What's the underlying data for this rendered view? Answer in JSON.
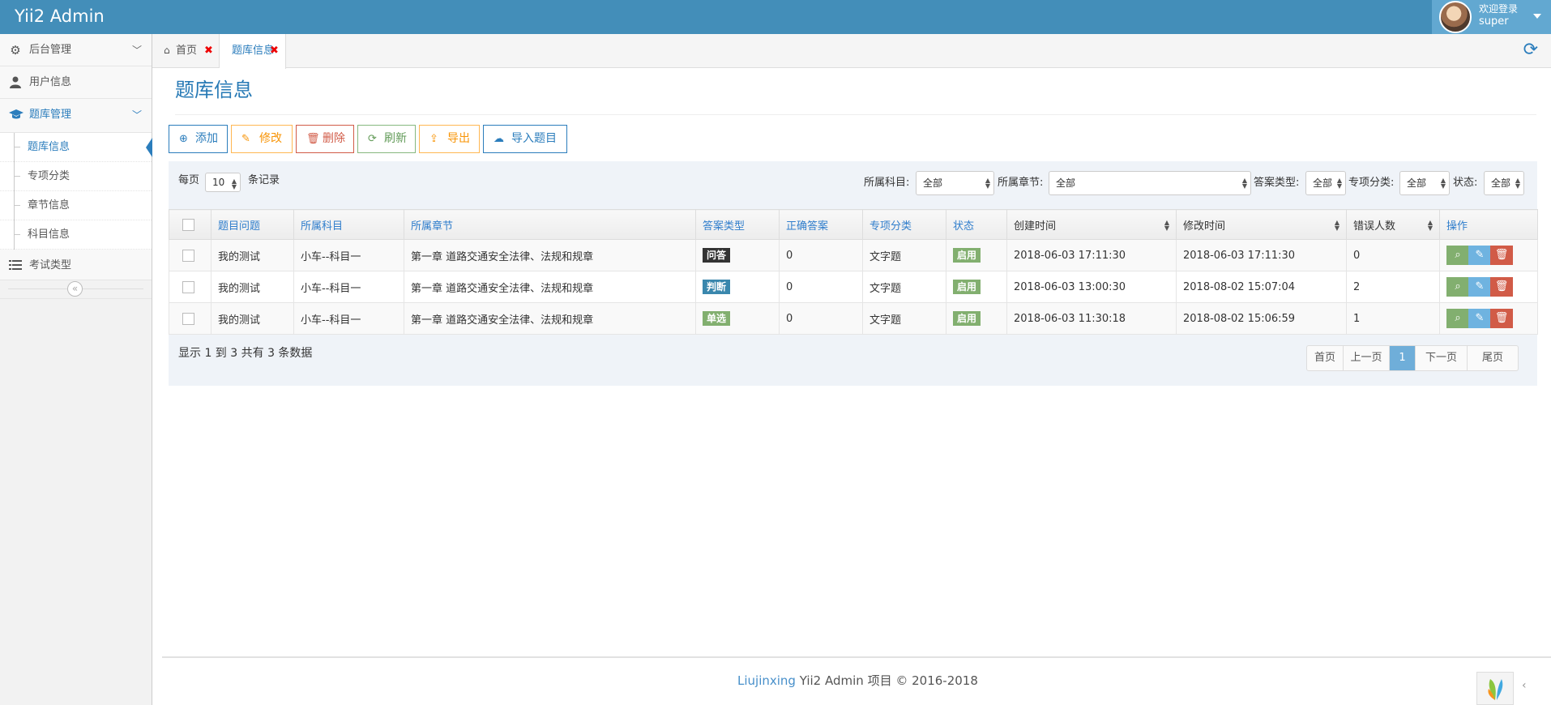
{
  "app": {
    "brand": "Yii2 Admin",
    "welcome": "欢迎登录",
    "username": "super"
  },
  "sidebar": {
    "items": [
      {
        "label": "后台管理",
        "icon": "gear-icon"
      },
      {
        "label": "用户信息",
        "icon": "user-icon"
      },
      {
        "label": "题库管理",
        "icon": "graduation-cap-icon"
      },
      {
        "label": "考试类型",
        "icon": "list-icon"
      }
    ],
    "submenu": [
      "题库信息",
      "专项分类",
      "章节信息",
      "科目信息"
    ],
    "collapse_glyph": "«"
  },
  "tabs": [
    {
      "label": "首页",
      "icon": "home-icon",
      "close": "✖"
    },
    {
      "label": "题库信息",
      "close": "✖"
    }
  ],
  "page": {
    "title": "题库信息"
  },
  "toolbar": {
    "add": "添加",
    "edit": "修改",
    "delete": "删除",
    "refresh": "刷新",
    "export": "导出",
    "import": "导入题目"
  },
  "filters": {
    "per_page_label": "每页",
    "per_page_value": "10",
    "records_label": "条记录",
    "subject_label": "所属科目:",
    "subject_value": "全部",
    "chapter_label": "所属章节:",
    "chapter_value": "全部",
    "answer_type_label": "答案类型:",
    "answer_type_value": "全部",
    "special_label": "专项分类:",
    "special_value": "全部",
    "status_label": "状态:",
    "status_value": "全部"
  },
  "table": {
    "headers": [
      "题目问题",
      "所属科目",
      "所属章节",
      "答案类型",
      "正确答案",
      "专项分类",
      "状态",
      "创建时间",
      "修改时间",
      "错误人数",
      "操作"
    ],
    "rows": [
      {
        "question": "我的测试",
        "subject": "小车--科目一",
        "chapter": "第一章 道路交通安全法律、法规和规章",
        "answer_type": "问答",
        "answer_color": "#333333",
        "correct": "0",
        "special": "文字题",
        "status": "启用",
        "created": "2018-06-03 17:11:30",
        "modified": "2018-06-03 17:11:30",
        "errors": "0"
      },
      {
        "question": "我的测试",
        "subject": "小车--科目一",
        "chapter": "第一章 道路交通安全法律、法规和规章",
        "answer_type": "判断",
        "answer_color": "#3a87ad",
        "correct": "0",
        "special": "文字题",
        "status": "启用",
        "created": "2018-06-03 13:00:30",
        "modified": "2018-08-02 15:07:04",
        "errors": "2"
      },
      {
        "question": "我的测试",
        "subject": "小车--科目一",
        "chapter": "第一章 道路交通安全法律、法规和规章",
        "answer_type": "单选",
        "answer_color": "#82af6f",
        "correct": "0",
        "special": "文字题",
        "status": "启用",
        "created": "2018-06-03 11:30:18",
        "modified": "2018-08-02 15:06:59",
        "errors": "1"
      }
    ]
  },
  "summary": "显示 1 到 3 共有 3 条数据",
  "pagination": {
    "first": "首页",
    "prev": "上一页",
    "current": "1",
    "next": "下一页",
    "last": "尾页"
  },
  "footer": {
    "author": "Liujinxing",
    "text": " Yii2 Admin 项目 © 2016-2018"
  },
  "colors": {
    "primary": "#438eb9",
    "accent": "#2b7dbc",
    "success": "#82af6f",
    "info": "#6fb3e0",
    "danger": "#d15b47",
    "warning": "#ffb752"
  }
}
